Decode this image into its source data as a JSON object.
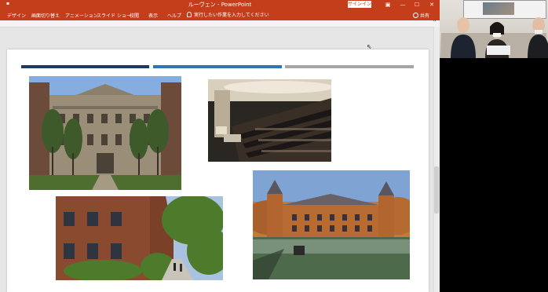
{
  "window": {
    "title_left_glyph": "▪",
    "document_title": "ルーヴェン - PowerPoint",
    "signin_label": "サインイン",
    "controls": {
      "ribbon_display": "▣",
      "minimize": "—",
      "maximize": "☐",
      "close": "✕"
    }
  },
  "ribbon": {
    "tabs": [
      "デザイン",
      "画面切り替え",
      "アニメーション",
      "スライド ショー",
      "校閲",
      "表示",
      "ヘルプ"
    ],
    "tell_me_placeholder": "実行したい作業を入力してください",
    "share_label": "共有",
    "collapse_glyph": "^"
  },
  "slide": {
    "accent_bars": [
      {
        "name": "navy",
        "color": "#1f3864"
      },
      {
        "name": "blue",
        "color": "#2e75b6"
      },
      {
        "name": "gray",
        "color": "#a6a6a6"
      }
    ],
    "photos": [
      {
        "name": "university-library-building",
        "desc_colors": [
          "#7da6dd",
          "#8a8070",
          "#3f5a2a"
        ]
      },
      {
        "name": "lecture-hall",
        "desc_colors": [
          "#1a1a1a",
          "#5a4a3a",
          "#dcd2c0"
        ]
      },
      {
        "name": "red-brick-courtyard",
        "desc_colors": [
          "#9bb6d9",
          "#8a4a30",
          "#3e6a26"
        ]
      },
      {
        "name": "arenberg-castle",
        "desc_colors": [
          "#7a9fcf",
          "#b2652f",
          "#3f5a3a"
        ]
      }
    ]
  },
  "video_panel": {
    "participants": 3
  },
  "colors": {
    "ppt_red": "#c43e1c",
    "workspace_gray": "#e6e6e6"
  }
}
